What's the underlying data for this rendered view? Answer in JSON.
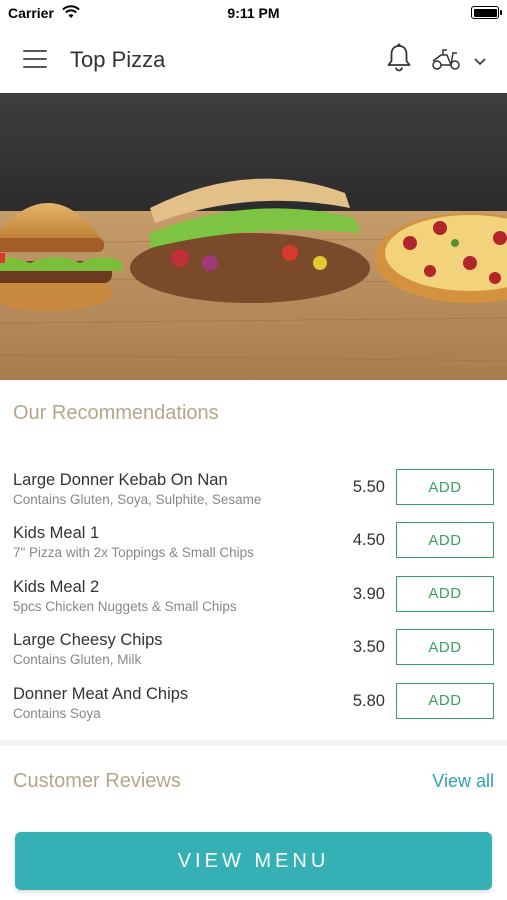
{
  "status_bar": {
    "carrier": "Carrier",
    "time": "9:11 PM"
  },
  "header": {
    "title": "Top Pizza"
  },
  "icons": {
    "menu": "hamburger-menu-icon",
    "notifications": "bell-icon",
    "delivery": "scooter-icon",
    "dropdown": "chevron-down-icon"
  },
  "hero": {
    "alt": "burger, kebab and pizza"
  },
  "recommendations": {
    "title": "Our Recommendations",
    "items": [
      {
        "name": "Large Donner Kebab On Nan",
        "desc": "Contains Gluten, Soya, Sulphite, Sesame",
        "price": "5.50",
        "button": "ADD"
      },
      {
        "name": "Kids Meal 1",
        "desc": "7\" Pizza with 2x Toppings & Small Chips",
        "price": "4.50",
        "button": "ADD"
      },
      {
        "name": "Kids Meal 2",
        "desc": "5pcs Chicken Nuggets & Small Chips",
        "price": "3.90",
        "button": "ADD"
      },
      {
        "name": "Large Cheesy Chips",
        "desc": "Contains Gluten, Milk",
        "price": "3.50",
        "button": "ADD"
      },
      {
        "name": "Donner Meat And Chips",
        "desc": "Contains Soya",
        "price": "5.80",
        "button": "ADD"
      }
    ]
  },
  "reviews": {
    "title": "Customer Reviews",
    "view_all": "View all"
  },
  "cta": {
    "label": "VIEW MENU"
  },
  "colors": {
    "accent": "#35b0b5",
    "add_green": "#3aa060",
    "section_title": "#b5a68a",
    "link": "#2fa2b5"
  }
}
